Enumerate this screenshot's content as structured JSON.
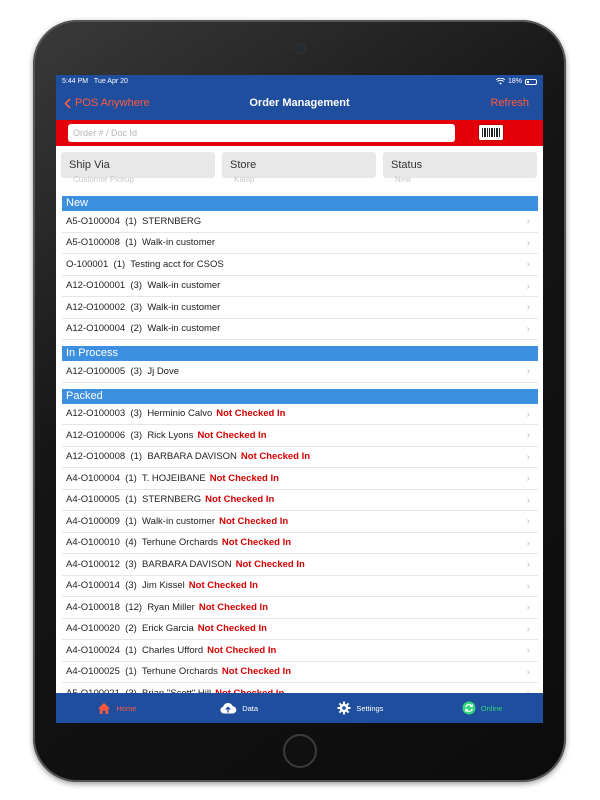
{
  "status_bar": {
    "time": "5:44 PM",
    "date": "Tue Apr 20",
    "battery": "18%"
  },
  "nav": {
    "back_label": "POS Anywhere",
    "title": "Order Management",
    "refresh_label": "Refresh"
  },
  "search": {
    "placeholder": "Order # / Doc Id"
  },
  "filters": [
    {
      "label": "Ship Via",
      "value": "Customer Pickup"
    },
    {
      "label": "Store",
      "value": "Kalep"
    },
    {
      "label": "Status",
      "value": "New"
    }
  ],
  "sections": [
    {
      "title": "New",
      "rows": [
        {
          "text": "A5-O100004  (1)  STERNBERG",
          "flag": ""
        },
        {
          "text": "A5-O100008  (1)  Walk-in customer",
          "flag": ""
        },
        {
          "text": "O-100001  (1)  Testing acct for CSOS",
          "flag": ""
        },
        {
          "text": "A12-O100001  (3)  Walk-in customer",
          "flag": ""
        },
        {
          "text": "A12-O100002  (3)  Walk-in customer",
          "flag": ""
        },
        {
          "text": "A12-O100004  (2)  Walk-in customer",
          "flag": ""
        }
      ]
    },
    {
      "title": "In Process",
      "rows": [
        {
          "text": "A12-O100005  (3)  Jj Dove",
          "flag": ""
        }
      ]
    },
    {
      "title": "Packed",
      "rows": [
        {
          "text": "A12-O100003  (3)  Herminio Calvo",
          "flag": "Not Checked In"
        },
        {
          "text": "A12-O100006  (3)  Rick Lyons",
          "flag": "Not Checked In"
        },
        {
          "text": "A12-O100008  (1)  BARBARA DAVISON",
          "flag": "Not Checked In"
        },
        {
          "text": "A4-O100004  (1)  T. HOJEIBANE",
          "flag": "Not Checked In"
        },
        {
          "text": "A4-O100005  (1)  STERNBERG",
          "flag": "Not Checked In"
        },
        {
          "text": "A4-O100009  (1)  Walk-in customer",
          "flag": "Not Checked In"
        },
        {
          "text": "A4-O100010  (4)  Terhune Orchards",
          "flag": "Not Checked In"
        },
        {
          "text": "A4-O100012  (3)  BARBARA DAVISON",
          "flag": "Not Checked In"
        },
        {
          "text": "A4-O100014  (3)  Jim Kissel",
          "flag": "Not Checked In"
        },
        {
          "text": "A4-O100018  (12)  Ryan Miller",
          "flag": "Not Checked In"
        },
        {
          "text": "A4-O100020  (2)  Erick Garcia",
          "flag": "Not Checked In"
        },
        {
          "text": "A4-O100024  (1)  Charles Ufford",
          "flag": "Not Checked In"
        },
        {
          "text": "A4-O100025  (1)  Terhune Orchards",
          "flag": "Not Checked In"
        },
        {
          "text": "A5-O100021  (3)  Brian \"Scott\" Hill",
          "flag": "Not Checked In"
        }
      ]
    }
  ],
  "tabs": [
    {
      "label": "Home",
      "icon": "home-icon"
    },
    {
      "label": "Data",
      "icon": "cloud-upload-icon"
    },
    {
      "label": "Settings",
      "icon": "gear-icon"
    },
    {
      "label": "Online",
      "icon": "sync-icon"
    }
  ],
  "colors": {
    "nav": "#1f4e9e",
    "accent": "#e4000b",
    "section": "#3d8fe0",
    "alert": "#d40000",
    "online": "#2fd67a"
  }
}
